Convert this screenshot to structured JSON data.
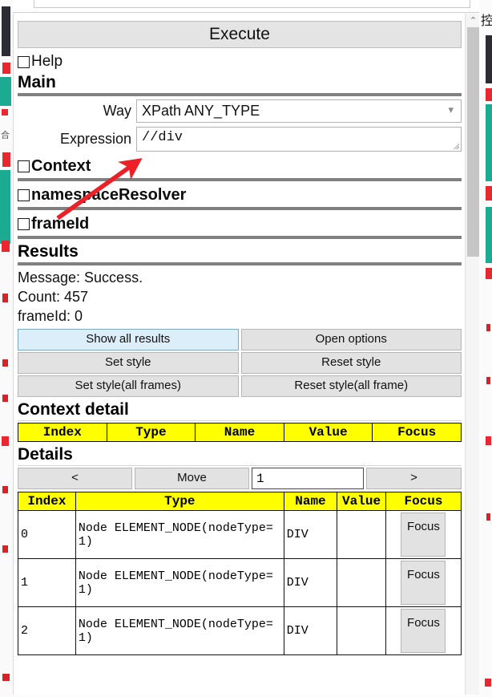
{
  "panel": {
    "execute_label": "Execute",
    "help_label": "Help",
    "main_heading": "Main",
    "way_label": "Way",
    "way_value": "XPath ANY_TYPE",
    "expression_label": "Expression",
    "expression_value": "//div",
    "context_label": "Context",
    "namespace_resolver_label": "namespaceResolver",
    "frameid_label": "frameId",
    "results_heading": "Results",
    "message_line": "Message: Success.",
    "count_line": "Count: 457",
    "frameid_line": "frameId: 0",
    "buttons": {
      "show_all_results": "Show all results",
      "open_options": "Open options",
      "set_style": "Set style",
      "reset_style": "Reset style",
      "set_style_all_frames": "Set style(all frames)",
      "reset_style_all_frame": "Reset style(all frame)"
    },
    "context_detail_heading": "Context detail",
    "context_detail_columns": [
      "Index",
      "Type",
      "Name",
      "Value",
      "Focus"
    ],
    "details_heading": "Details",
    "move_prev_label": "<",
    "move_label": "Move",
    "move_value": "1",
    "move_next_label": ">",
    "details_columns": [
      "Index",
      "Type",
      "Name",
      "Value",
      "Focus"
    ],
    "details_rows": [
      {
        "index": "0",
        "type": "Node ELEMENT_NODE(nodeType=1)",
        "name": "DIV",
        "value": "",
        "focus": "Focus"
      },
      {
        "index": "1",
        "type": "Node ELEMENT_NODE(nodeType=1)",
        "name": "DIV",
        "value": "",
        "focus": "Focus"
      },
      {
        "index": "2",
        "type": "Node ELEMENT_NODE(nodeType=1)",
        "name": "DIV",
        "value": "",
        "focus": "Focus"
      }
    ]
  },
  "scrollbar": {
    "up_arrow": "⌃"
  },
  "edge": {
    "clipped_glyph": "控"
  },
  "colors": {
    "header_yellow": "#ffff00",
    "primary_button": "#ddeefb",
    "button_face": "#e2e2e2",
    "annotation_red": "#ec2026",
    "separator_gray": "#808080"
  }
}
